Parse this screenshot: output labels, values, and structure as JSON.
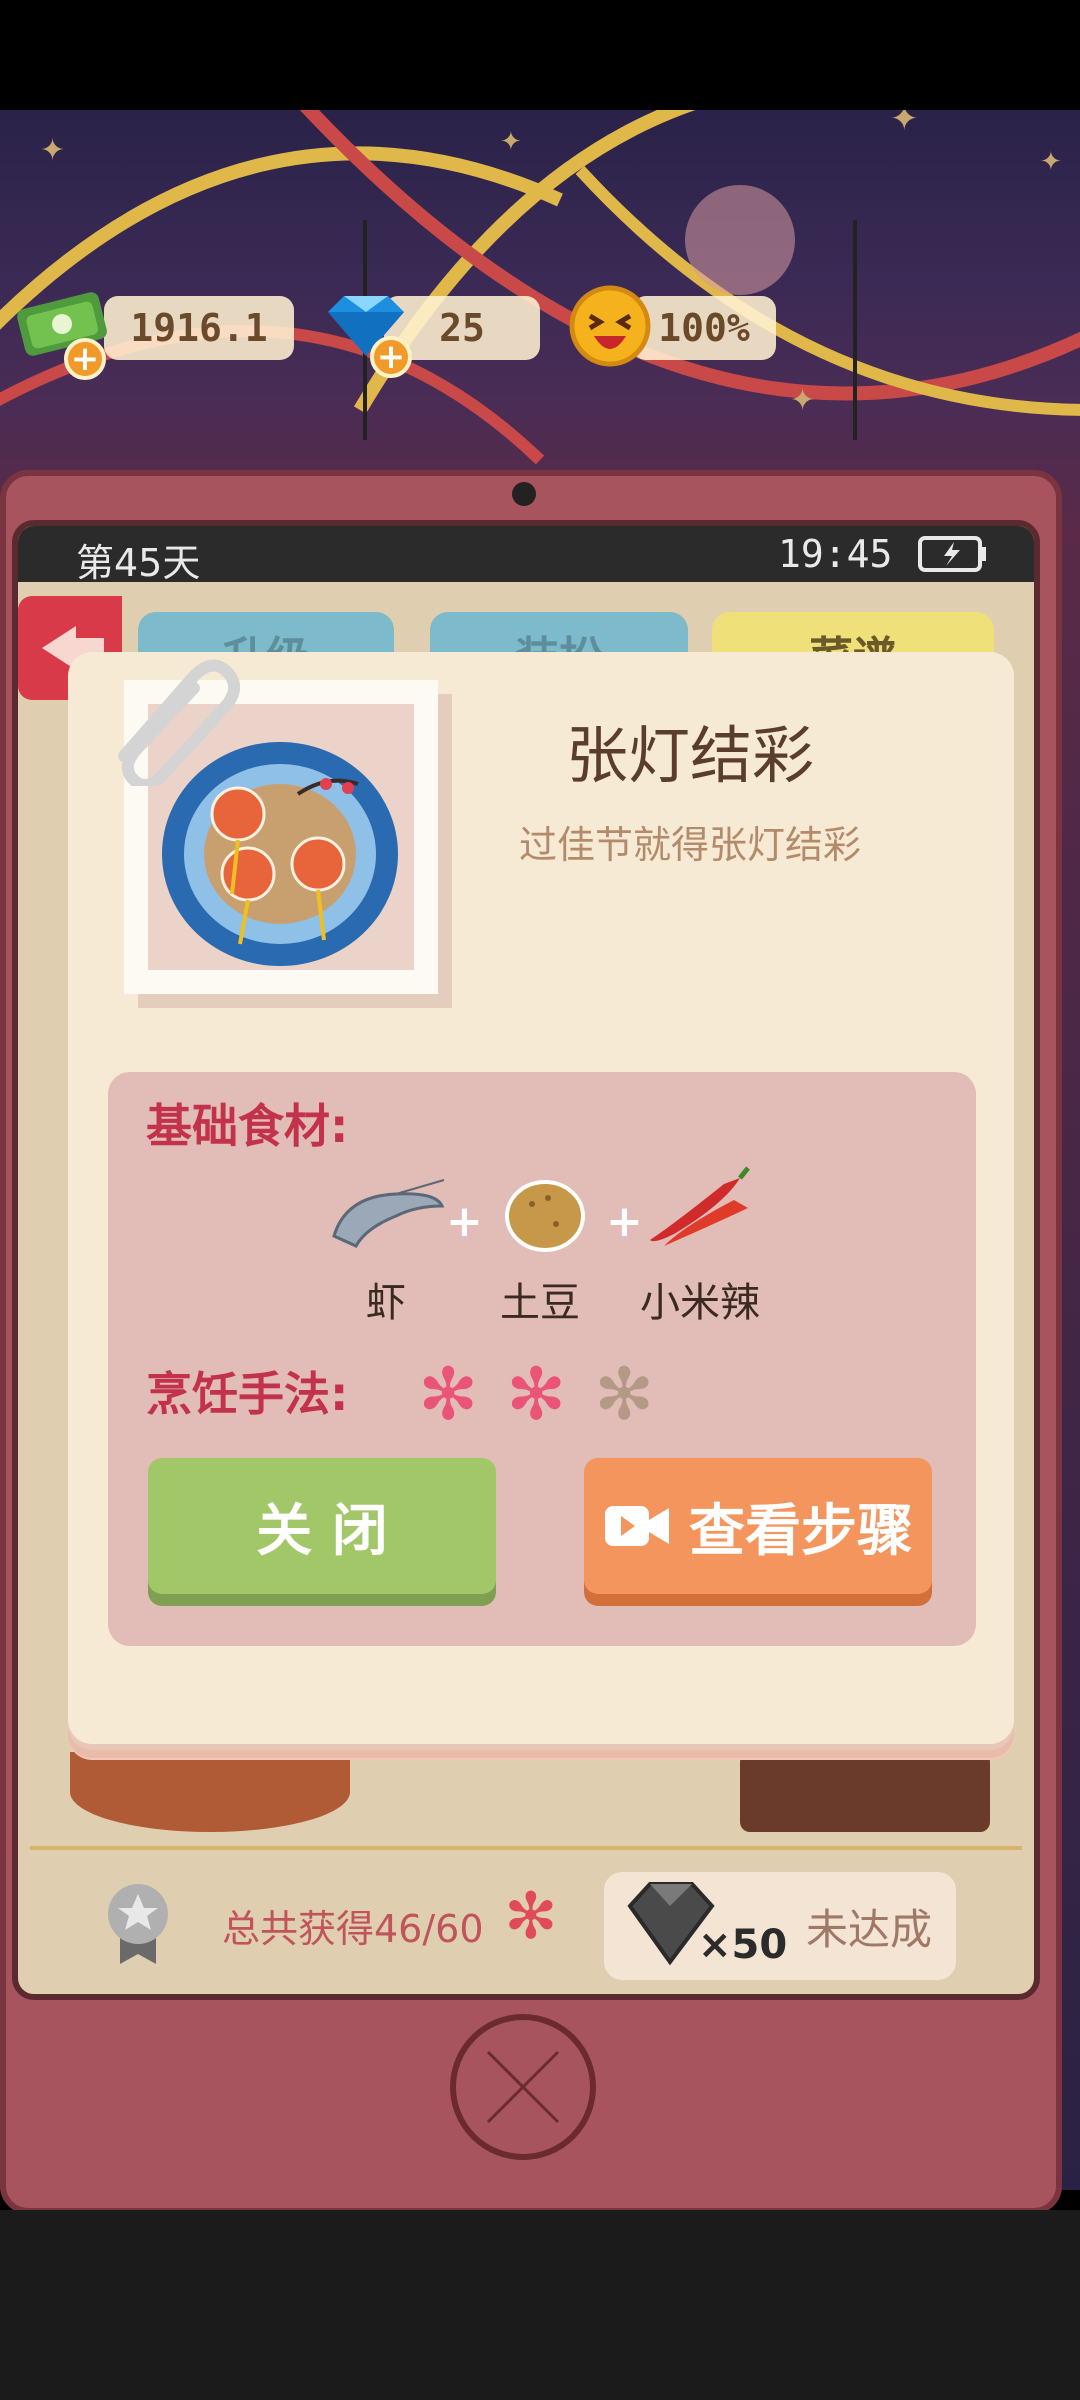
{
  "hud": {
    "money": "1916.1",
    "diamonds": "25",
    "satisfaction": "100%"
  },
  "phone": {
    "day": "第45天",
    "time": "19:45",
    "tabs": [
      "升级",
      "装扮",
      "菜谱"
    ]
  },
  "dish": {
    "title": "张灯结彩",
    "description": "过佳节就得张灯结彩"
  },
  "ingredients": {
    "label": "基础食材:",
    "items": [
      {
        "name": "虾",
        "icon": "shrimp-icon"
      },
      {
        "name": "土豆",
        "icon": "potato-icon"
      },
      {
        "name": "小米辣",
        "icon": "chili-icon"
      }
    ]
  },
  "cooking": {
    "label": "烹饪手法:",
    "level": 2,
    "max": 3
  },
  "buttons": {
    "close": "关 闭",
    "steps": "查看步骤"
  },
  "summary": {
    "text": "总共获得46/60",
    "reward": "×50",
    "status": "未达成"
  },
  "colors": {
    "accent_red": "#c2324a",
    "close_green": "#a1c769",
    "steps_orange": "#f3955c"
  }
}
